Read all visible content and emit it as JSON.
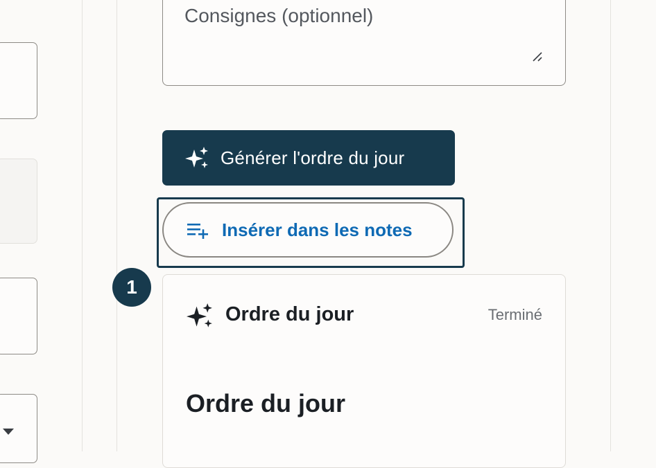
{
  "form": {
    "instructions_placeholder": "Consignes (optionnel)"
  },
  "actions": {
    "generate_label": "Générer l'ordre du jour",
    "insert_label": "Insérer dans les notes"
  },
  "step": {
    "number": "1"
  },
  "result_card": {
    "header_title": "Ordre du jour",
    "status": "Terminé",
    "content_title": "Ordre du jour"
  },
  "colors": {
    "primary": "#173a4d",
    "link": "#0f6ab4",
    "background": "#fbfaf8"
  },
  "icons": {
    "generate": "sparkle-icon",
    "insert": "list-add-icon",
    "card_header": "sparkle-icon",
    "textarea_resize": "resize-grip-icon",
    "left_select": "caret-down-icon"
  }
}
